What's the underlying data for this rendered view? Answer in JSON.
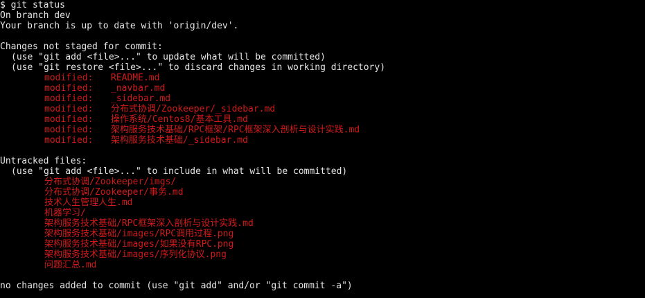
{
  "prompt": "$ git status",
  "branch_line": "On branch dev",
  "upstream_line": "Your branch is up to date with 'origin/dev'.",
  "not_staged": {
    "header": "Changes not staged for commit:",
    "hints": [
      "(use \"git add <file>...\" to update what will be committed)",
      "(use \"git restore <file>...\" to discard changes in working directory)"
    ],
    "files": [
      {
        "status": "modified:",
        "path": "README.md"
      },
      {
        "status": "modified:",
        "path": "_navbar.md"
      },
      {
        "status": "modified:",
        "path": "_sidebar.md"
      },
      {
        "status": "modified:",
        "path": "分布式协调/Zookeeper/_sidebar.md"
      },
      {
        "status": "modified:",
        "path": "操作系统/Centos8/基本工具.md"
      },
      {
        "status": "modified:",
        "path": "架构服务技术基础/RPC框架/RPC框架深入剖析与设计实践.md"
      },
      {
        "status": "modified:",
        "path": "架构服务技术基础/_sidebar.md"
      }
    ]
  },
  "untracked": {
    "header": "Untracked files:",
    "hint": "(use \"git add <file>...\" to include in what will be committed)",
    "files": [
      "分布式协调/Zookeeper/imgs/",
      "分布式协调/Zookeeper/事务.md",
      "技术人生管理人生.md",
      "机器学习/",
      "架构服务技术基础/RPC框架深入剖析与设计实践.md",
      "架构服务技术基础/images/RPC调用过程.png",
      "架构服务技术基础/images/如果没有RPC.png",
      "架构服务技术基础/images/序列化协议.png",
      "问题汇总.md"
    ]
  },
  "footer": "no changes added to commit (use \"git add\" and/or \"git commit -a\")",
  "colors": {
    "background": "#000000",
    "text": "#e6e6e6",
    "changed": "#d11a1a"
  }
}
